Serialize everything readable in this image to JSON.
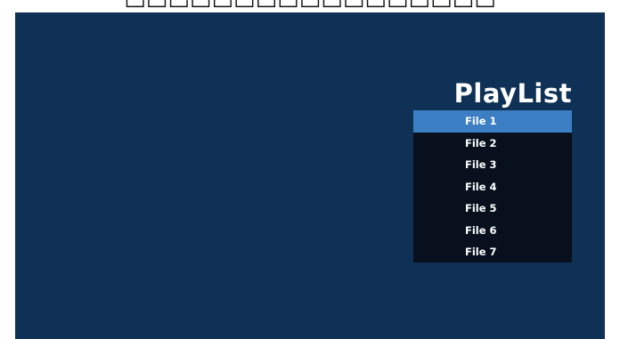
{
  "header": {
    "caption": "□□□□□□□□□□□□□□□□□"
  },
  "playlist": {
    "title": "PlayList",
    "selected_index": 0,
    "items": [
      {
        "label": "File 1"
      },
      {
        "label": "File 2"
      },
      {
        "label": "File 3"
      },
      {
        "label": "File 4"
      },
      {
        "label": "File 5"
      },
      {
        "label": "File 6"
      },
      {
        "label": "File 7"
      }
    ]
  },
  "colors": {
    "screen_background": "#0e3155",
    "list_background": "#07101c",
    "selection": "#3b7ec3",
    "text": "#ffffff"
  }
}
